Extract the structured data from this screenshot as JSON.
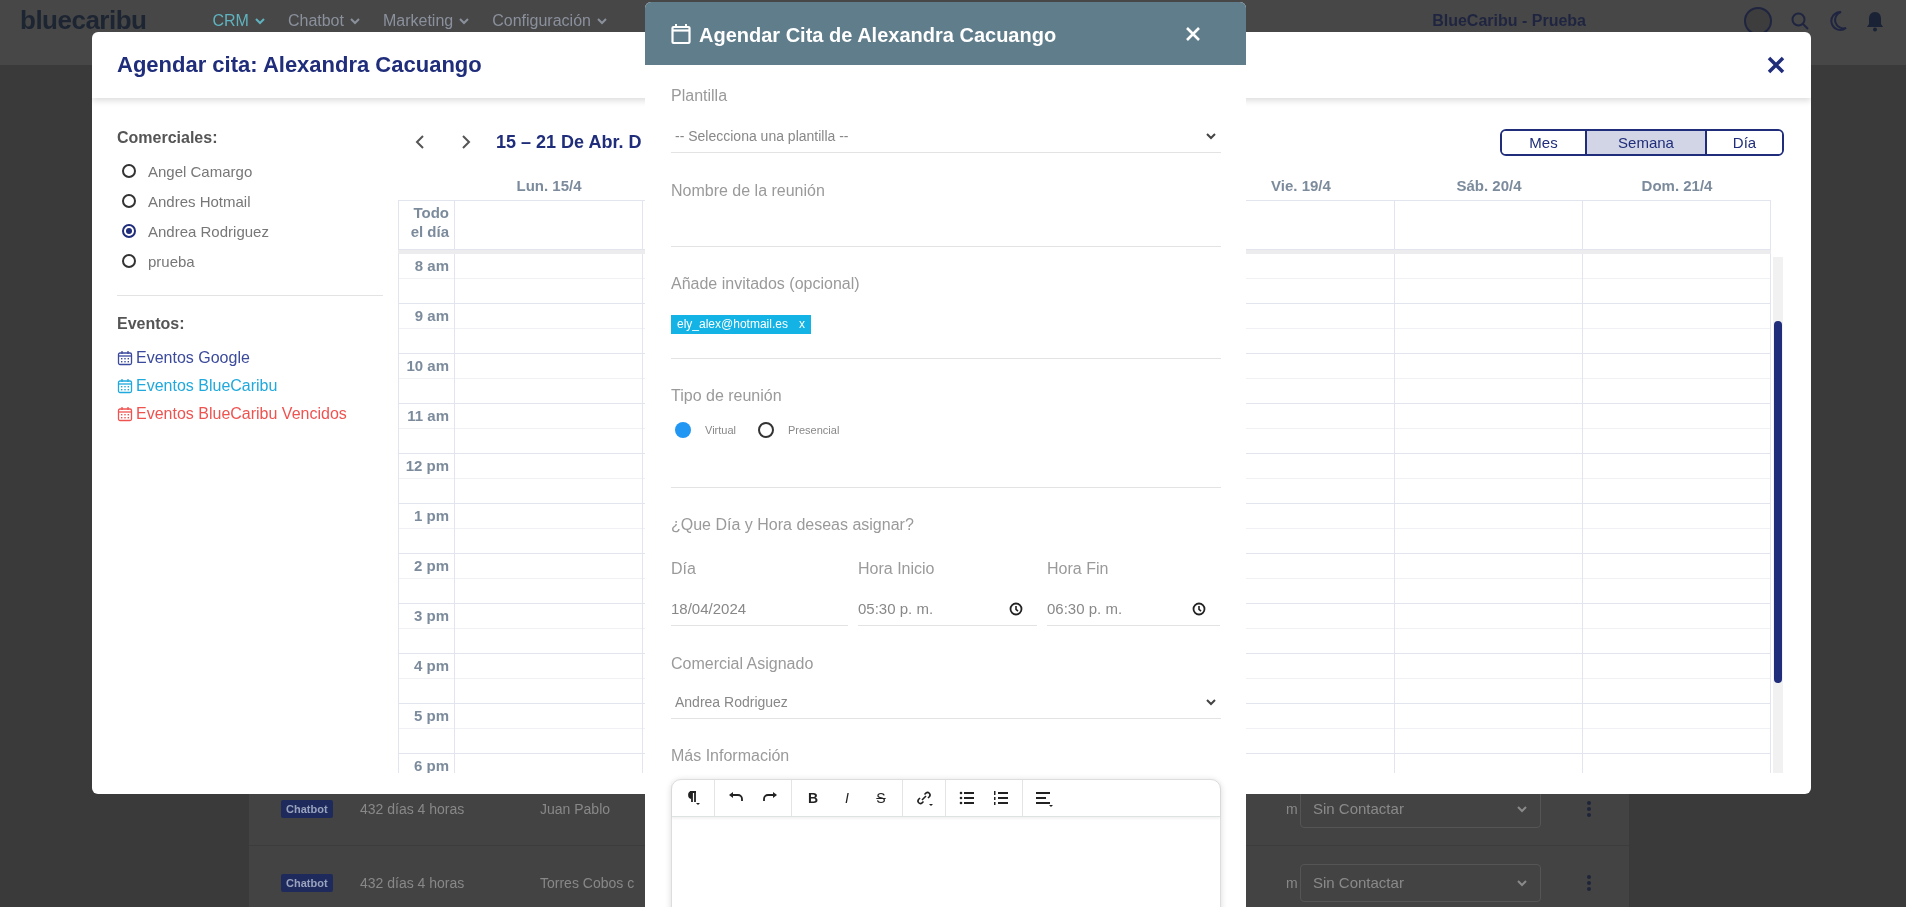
{
  "top_bar": {
    "logo": "bluecaribu",
    "nav": [
      {
        "label": "CRM",
        "selected": true
      },
      {
        "label": "Chatbot",
        "selected": false
      },
      {
        "label": "Marketing",
        "selected": false
      },
      {
        "label": "Configuración",
        "selected": false
      }
    ],
    "account": "BlueCaribu - Prueba"
  },
  "background_table": {
    "rows": [
      {
        "channel": "Chatbot",
        "age": "432 días 4 horas",
        "name": "Juan Pablo",
        "column_4": "m",
        "status": "Sin Contactar"
      },
      {
        "channel": "Chatbot",
        "age": "432 días 4 horas",
        "name": "Torres Cobos c",
        "column_4": "m",
        "status": "Sin Contactar"
      }
    ]
  },
  "schedule_modal": {
    "title": "Agendar cita: Alexandra Cacuango",
    "commercials_heading": "Comerciales:",
    "commercials": [
      {
        "name": "Angel Camargo",
        "selected": false
      },
      {
        "name": "Andres Hotmail",
        "selected": false
      },
      {
        "name": "Andrea Rodriguez",
        "selected": true
      },
      {
        "name": "prueba",
        "selected": false
      }
    ],
    "events_heading": "Eventos:",
    "event_sources": [
      {
        "label": "Eventos Google",
        "color": "#3b4a9c"
      },
      {
        "label": "Eventos BlueCaribu",
        "color": "#1fa9dc"
      },
      {
        "label": "Eventos BlueCaribu Vencidos",
        "color": "#ef5350"
      }
    ],
    "calendar": {
      "range_title": "15 – 21 De Abr. D",
      "views": [
        {
          "label": "Mes",
          "selected": false
        },
        {
          "label": "Semana",
          "selected": true
        },
        {
          "label": "Día",
          "selected": false
        }
      ],
      "day_headers": [
        "Lun. 15/4",
        "Vie. 19/4",
        "Sáb. 20/4",
        "Dom. 21/4"
      ],
      "all_day_label": "Todo el día",
      "hours": [
        "8 am",
        "9 am",
        "10 am",
        "11 am",
        "12 pm",
        "1 pm",
        "2 pm",
        "3 pm",
        "4 pm",
        "5 pm",
        "6 pm"
      ]
    }
  },
  "appointment_dialog": {
    "title": "Agendar Cita de Alexandra Cacuango",
    "template": {
      "label": "Plantilla",
      "value": "-- Selecciona una plantilla --"
    },
    "meeting_name": {
      "label": "Nombre de la reunión"
    },
    "guests": {
      "label": "Añade invitados (opcional)",
      "chips": [
        {
          "email": "ely_alex@hotmail.es",
          "remove": "x"
        }
      ]
    },
    "meeting_type": {
      "label": "Tipo de reunión",
      "options": [
        {
          "label": "Virtual",
          "selected": true
        },
        {
          "label": "Presencial",
          "selected": false
        }
      ]
    },
    "when_heading": "¿Que Día y Hora deseas asignar?",
    "date": {
      "label": "Día",
      "value": "18/04/2024"
    },
    "start": {
      "label": "Hora Inicio",
      "value": "05:30 p. m."
    },
    "end": {
      "label": "Hora Fin",
      "value": "06:30 p. m."
    },
    "assigned": {
      "label": "Comercial Asignado",
      "value": "Andrea Rodriguez"
    },
    "more_info": {
      "label": "Más Información",
      "toolbar": [
        [
          {
            "kind": "paragraph"
          }
        ],
        [
          {
            "kind": "undo"
          },
          {
            "kind": "redo"
          }
        ],
        [
          {
            "kind": "bold",
            "label": "B"
          },
          {
            "kind": "italic",
            "label": "I"
          },
          {
            "kind": "strike",
            "label": "S"
          }
        ],
        [
          {
            "kind": "link"
          }
        ],
        [
          {
            "kind": "bullets"
          },
          {
            "kind": "numbers"
          }
        ],
        [
          {
            "kind": "align"
          }
        ]
      ]
    }
  }
}
